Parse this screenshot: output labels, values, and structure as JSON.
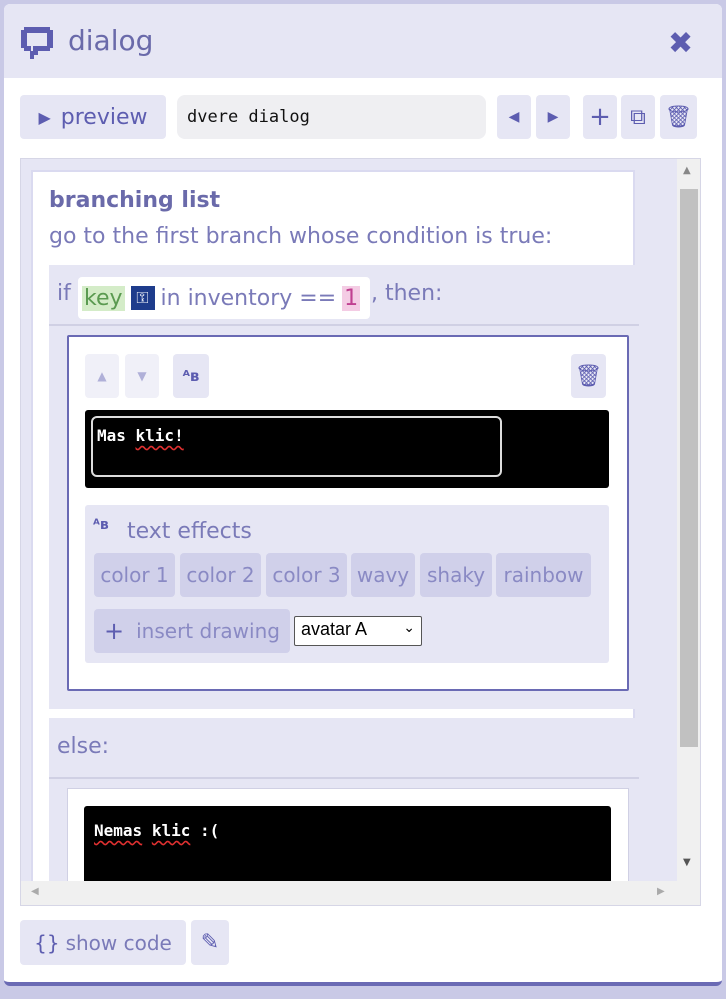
{
  "header": {
    "title": "dialog",
    "close_icon": "close-icon"
  },
  "toolbar": {
    "preview_label": "preview",
    "name_value": "dvere dialog"
  },
  "branching": {
    "title": "branching list",
    "subtitle": "go to the first branch whose condition is true:"
  },
  "condition": {
    "prefix": "if",
    "item": "key",
    "middle": "in inventory ==",
    "value": "1",
    "suffix": ", then:"
  },
  "branch1": {
    "text_plain": "Mas ",
    "text_word": "klic!",
    "effects_label": "text effects",
    "effects": [
      "color 1",
      "color 2",
      "color 3",
      "wavy",
      "shaky",
      "rainbow"
    ],
    "insert_label": "insert drawing",
    "drawing_select": "avatar A"
  },
  "else_block": {
    "label": "else:",
    "text_word1": "Nemas",
    "text_word2": "klic",
    "text_rest": " :("
  },
  "footer": {
    "show_code_label": "show code"
  },
  "colors": {
    "accent": "#6a6ab4",
    "panel": "#e6e6f4",
    "button": "#d0d0ea",
    "key_bg": "#d4ecc8",
    "value_bg": "#f4cce4"
  }
}
